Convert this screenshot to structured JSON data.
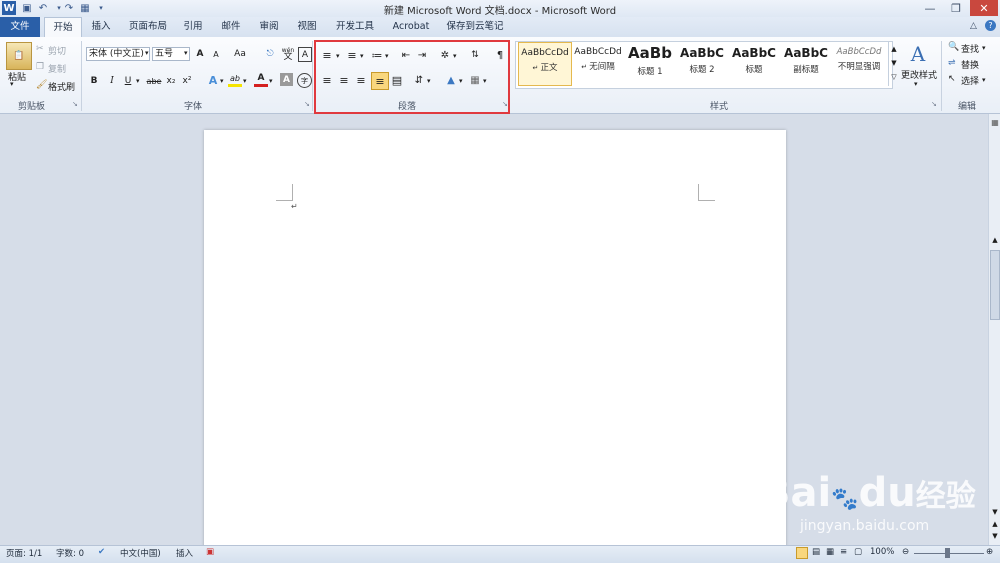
{
  "window": {
    "title": "新建 Microsoft Word 文档.docx - Microsoft Word"
  },
  "tabs": [
    "文件",
    "开始",
    "插入",
    "页面布局",
    "引用",
    "邮件",
    "审阅",
    "视图",
    "开发工具",
    "Acrobat",
    "保存到云笔记"
  ],
  "active_tab": "开始",
  "clipboard": {
    "paste_label": "粘贴",
    "cut_label": "剪切",
    "copy_label": "复制",
    "format_painter_label": "格式刷",
    "group_label": "剪贴板"
  },
  "font": {
    "font_name": "宋体 (中文正)",
    "font_size": "五号",
    "group_label": "字体",
    "grow_label": "A",
    "shrink_label": "A",
    "case_label": "Aa",
    "wen_label": "wén",
    "char_border_label": "A",
    "bold_label": "B",
    "italic_label": "I",
    "underline_label": "U",
    "strike_label": "abe",
    "sub_label": "x₂",
    "sup_label": "x²",
    "effects_label": "A",
    "highlight_label": "ab",
    "color_label": "A",
    "shading_label": "A",
    "enclose_label": "字"
  },
  "paragraph": {
    "group_label": "段落"
  },
  "styles": {
    "group_label": "样式",
    "items": [
      {
        "preview": "AaBbCcDd",
        "name": "正文"
      },
      {
        "preview": "AaBbCcDd",
        "name": "无间隔"
      },
      {
        "preview": "AaBb",
        "name": "标题 1"
      },
      {
        "preview": "AaBbC",
        "name": "标题 2"
      },
      {
        "preview": "AaBbC",
        "name": "标题"
      },
      {
        "preview": "AaBbC",
        "name": "副标题"
      },
      {
        "preview": "AaBbCcDd",
        "name": "不明显强调"
      }
    ],
    "change_styles_label": "更改样式"
  },
  "editing": {
    "group_label": "编辑",
    "find_label": "查找",
    "replace_label": "替换",
    "select_label": "选择"
  },
  "status": {
    "page": "页面: 1/1",
    "words": "字数: 0",
    "language": "中文(中国)",
    "mode": "插入",
    "zoom": "100%"
  },
  "watermark": {
    "brand": "Bai",
    "brand2": "du",
    "cn": "经验",
    "url": "jingyan.baidu.com"
  },
  "colors": {
    "accent": "#2a5fa8",
    "highlight_box": "#e0393e",
    "font_color_bar": "#d42020",
    "highlight_bar": "#f5e400"
  }
}
